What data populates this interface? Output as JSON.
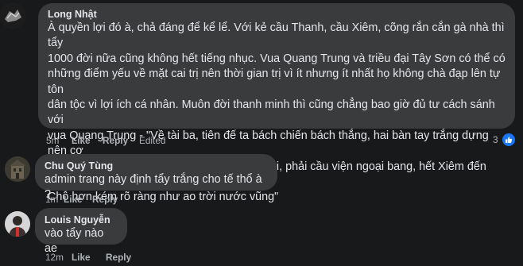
{
  "comments": [
    {
      "author": "Long Nhật",
      "lines": [
        "À quyền lợi đó à, chả đáng để kể lể. Với kẻ cầu Thanh, cầu Xiêm, cõng rắn cắn gà nhà thì tẩy",
        "1000 đời nữa cũng không hết tiếng nhục. Vua Quang Trung và triều đại Tây Sơn có thể có",
        "những điểm yếu về mặt cai trị nên thời gian trị vì ít nhưng ít nhất họ không chà đạp lên tự tôn",
        "dân tộc vì lợi ích cá nhân. Muôn đời thanh minh thì cũng chẳng bao giờ đủ tư cách sánh với",
        "vua Quang Trung - \"Về tài ba, tiên đế ta bách chiến bách thắng, hai bàn tay trắng dựng nên cơ",
        "đồ. Còn nhà ngươi bị đánh trốn chui trốn nhủi, phải cầu viện ngoại bang, hết Xiêm đến Pháp.",
        "Chỗ hơn kém rõ ràng như ao trời nước vũng\""
      ],
      "time": "5m",
      "like": "Like",
      "reply": "Reply",
      "edited": "Edited",
      "reaction_count": "3",
      "avatar_color": "#2b2b2b"
    },
    {
      "author": "Chu Quý Tùng",
      "lines": [
        "admin trang này định tẩy trắng cho tế thổ à ?"
      ],
      "time": "1m",
      "like": "Like",
      "reply": "Reply",
      "avatar_color": "#4a4436"
    },
    {
      "author": "Louis Nguyễn",
      "lines": [
        "vào tẩy nào ae"
      ],
      "time": "12m",
      "like": "Like",
      "reply": "Reply",
      "avatar_color": "#cfcfcf"
    }
  ],
  "colors": {
    "background": "#18191a",
    "bubble": "#3a3b3c",
    "text": "#e4e6eb",
    "secondary": "#b0b3b8",
    "like_blue": "#1877f2"
  }
}
